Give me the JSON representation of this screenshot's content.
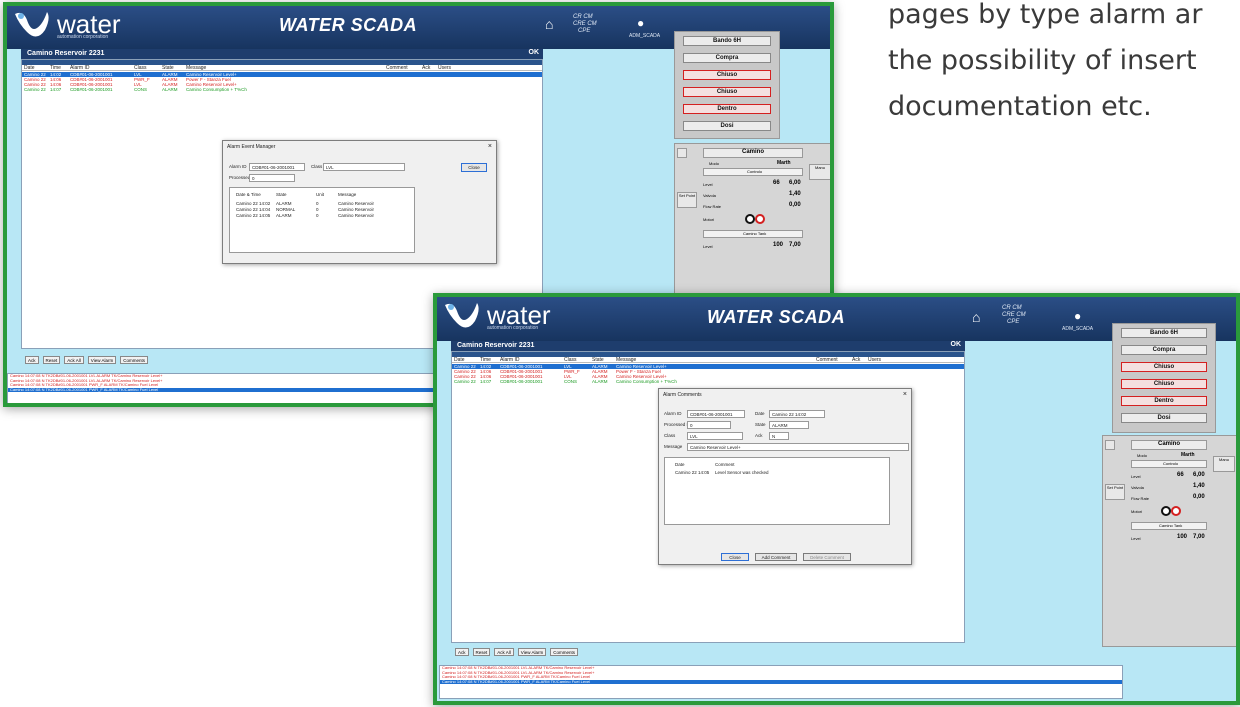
{
  "caption": {
    "lines": [
      "pages by type alarm ar",
      "the possibility of insert",
      "documentation etc."
    ]
  },
  "app": {
    "logo_text": "water",
    "logo_subtext": "automation corporation",
    "title": "WATER SCADA",
    "status_codes": [
      "CR",
      "CM",
      "CRE",
      "CM",
      "CN",
      "CPE"
    ],
    "user_name": "ADM_SCADA",
    "reservoir_title": "Camino Reservoir 2231",
    "checkbox": "OK"
  },
  "alarm_table": {
    "columns": [
      "Date",
      "Time",
      "Alarm ID",
      "Class",
      "State",
      "Message",
      "Comment",
      "Ack",
      "Users"
    ],
    "rows": [
      {
        "date": "Camino 22",
        "time": "14:02",
        "id": "CDB#01-06-2001001",
        "class": "LVL",
        "state": "ALARM",
        "msg": "Camino Reservoir Level+",
        "color": "sel"
      },
      {
        "date": "Camino 22",
        "time": "14:06",
        "id": "CDB#01-06-2001001",
        "class": "PWR_F",
        "state": "ALARM",
        "msg": "Power F - Stanza Fuel",
        "color": "red"
      },
      {
        "date": "Camino 22",
        "time": "14:06",
        "id": "CDB#01-06-2001001",
        "class": "LVL",
        "state": "ALARM",
        "msg": "Camino Reservoir Level+",
        "color": "red"
      },
      {
        "date": "Camino 22",
        "time": "14:07",
        "id": "CDB#01-06-2001001",
        "class": "CONS",
        "state": "ALARM",
        "msg": "Camino Consumption + T%Ch",
        "color": "green"
      }
    ]
  },
  "dialog1": {
    "title": "Alarm Event Manager",
    "alarm_id_label": "Alarm ID",
    "alarm_id": "CDB#01-06-2001001",
    "class_label": "Class",
    "class_value": "LVL",
    "percent_label": "Processed Id",
    "percent_value": "0",
    "button": "Close",
    "cols": [
      "Date & Time",
      "State",
      "Unit",
      "Message"
    ],
    "rows": [
      [
        "Camino 22 14:02",
        "ALARM",
        "0",
        "Camino Reservoir"
      ],
      [
        "Camino 22 14:04",
        "NORMAL",
        "0",
        "Camino Reservoir"
      ],
      [
        "Camino 22 14:05",
        "ALARM",
        "0",
        "Camino Reservoir"
      ]
    ]
  },
  "dialog2": {
    "title": "Alarm Comments",
    "alarm_id_label": "Alarm ID",
    "alarm_id": "CDB#01-06-2001001",
    "date_label": "Date",
    "date_value": "Camino 22 14:02",
    "process_label": "Processed Id",
    "process_value": "0",
    "state_label": "State",
    "state_value": "ALARM",
    "class_label": "Class",
    "class_value": "LVL",
    "ack_label": "Ack",
    "ack_value": "N",
    "message_label": "Message",
    "message_value": "Camino Reservoir Level+",
    "list_cols": [
      "Date",
      "Comment"
    ],
    "list_rows": [
      [
        "Camino 22 14:05",
        "Level Sensor was checked"
      ]
    ],
    "buttons": [
      "Close",
      "Add Comment",
      "Delete Comment"
    ]
  },
  "bottom_buttons": [
    "Ack",
    "Reset",
    "Ack All",
    "View Alarm",
    "Comments"
  ],
  "log_rows": [
    {
      "text": "Camino 14:07:08 N TK2DB#01-06-2001001 LVL ALARM TK/Camino Reservoir Level+",
      "sel": false
    },
    {
      "text": "Camino 14:07:08 N TK2DB#01-06-2001001 LVL ALARM TK/Camino Reservoir Level+",
      "sel": false
    },
    {
      "text": "Camino 14:07:08 N TK2DB#01-06-2001001 PWR_F ALARM TK/Camino Fuel Level",
      "sel": false
    },
    {
      "text": "Camino 14:07:08 N TK2DB#01-06-2001001 PWR_F ALARM TK/Camino Fuel Level",
      "sel": true
    }
  ],
  "right_panel": {
    "buttons": [
      "Bando 6H",
      "Compra",
      "Chiuso",
      "Chiuso",
      "Dentro",
      "Dosi"
    ],
    "red_buttons": [
      false,
      false,
      true,
      true,
      true,
      false
    ]
  },
  "control_panel": {
    "title": "Camino",
    "mode_label": "Modo",
    "mode_value": "Marth",
    "section": "Controlo",
    "side_label": "Manu",
    "set_label": "Set Point",
    "rows": [
      {
        "label": "Level",
        "a": "66",
        "b": "6,00"
      },
      {
        "label": "Valvola",
        "a": "",
        "b": "1,40"
      },
      {
        "label": "Flow Rate",
        "a": "",
        "b": "0,00"
      }
    ],
    "motor_label": "Motori",
    "tank_label": "Camino Tank",
    "tank_row": {
      "label": "Level",
      "a": "100",
      "b": "7,00"
    }
  }
}
